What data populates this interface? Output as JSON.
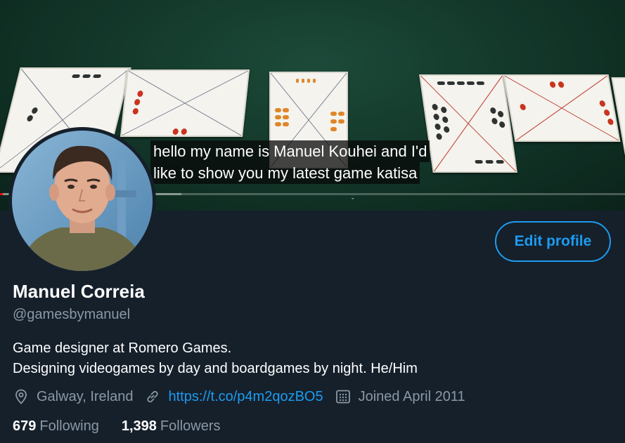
{
  "banner": {
    "caption_line1": "hello my name is Manuel Kouhei and I'd",
    "caption_line2": "like to show you my latest game katisa",
    "progress": 0.005,
    "buffered": 0.29
  },
  "profile": {
    "name": "Manuel Correia",
    "handle": "@gamesbymanuel",
    "bio_line1": "Game designer at Romero Games.",
    "bio_line2": "Designing videogames by day and boardgames by night. He/Him",
    "edit_label": "Edit profile",
    "location": "Galway, Ireland",
    "link": "https://t.co/p4m2qozBO5",
    "joined": "Joined April 2011"
  },
  "stats": {
    "following_count": "679",
    "following_label": "Following",
    "followers_count": "1,398",
    "followers_label": "Followers"
  },
  "icons": {
    "location": "location-pin-icon",
    "link": "link-icon",
    "joined": "calendar-icon"
  },
  "colors": {
    "background": "#15202b",
    "accent": "#1d9bf0",
    "muted": "#8b98a5"
  }
}
